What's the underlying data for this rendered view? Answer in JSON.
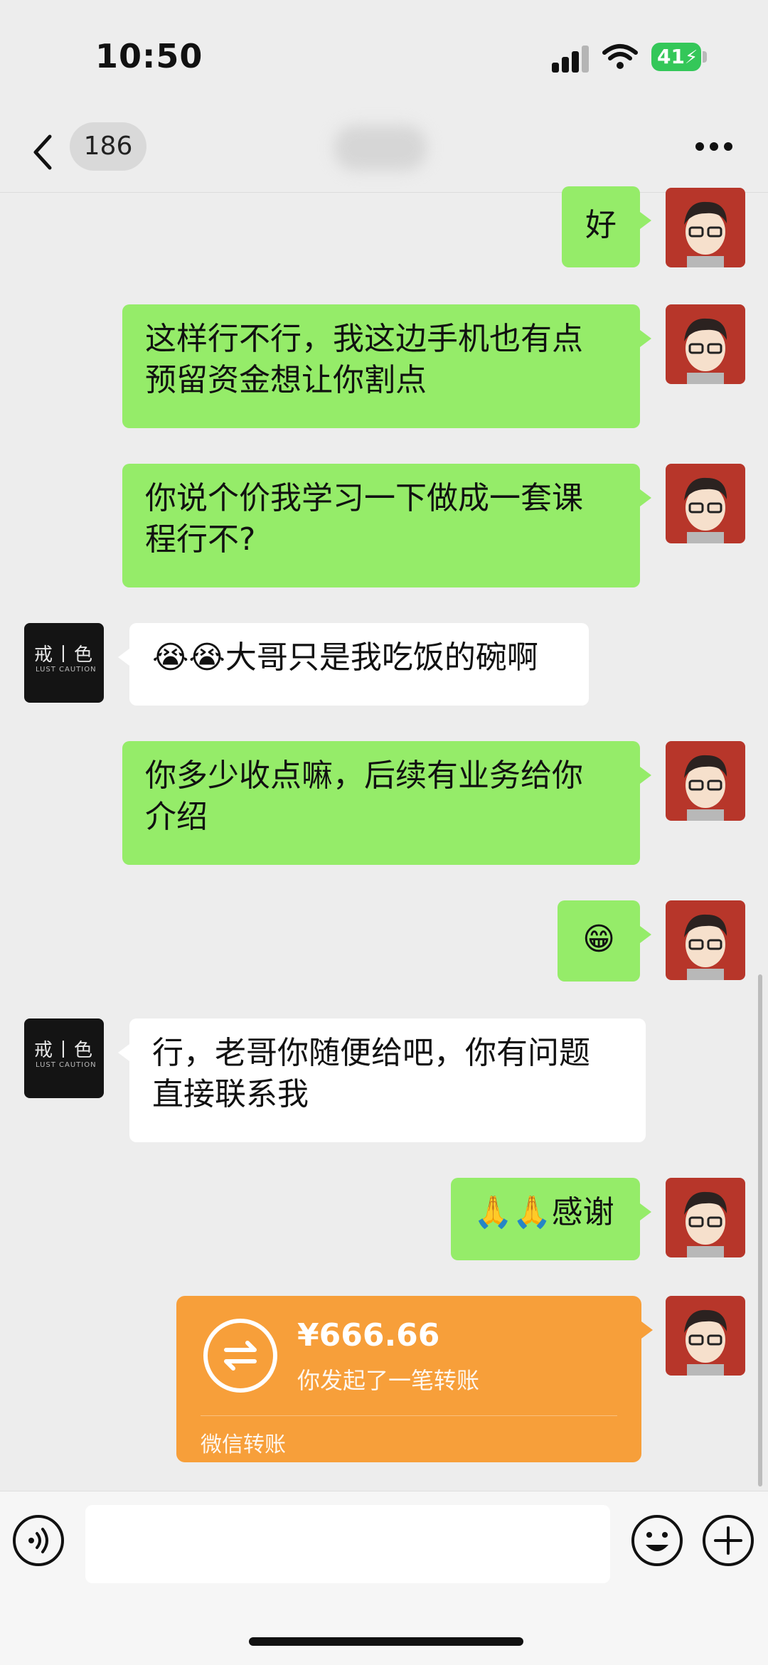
{
  "status_bar": {
    "time": "10:50",
    "battery": "41"
  },
  "nav": {
    "unread_count": "186"
  },
  "messages": [
    {
      "side": "out",
      "text": "好"
    },
    {
      "side": "out",
      "line1": "这样行不行，我这边手机也有点",
      "line2": "预留资金想让你割点"
    },
    {
      "side": "out",
      "line1": "你说个价我学习一下做成一套课",
      "line2": "程行不?"
    },
    {
      "side": "in",
      "emoji": "😭😭",
      "text": "大哥只是我吃饭的碗啊"
    },
    {
      "side": "out",
      "line1": "你多少收点嘛，后续有业务给你",
      "line2": "介绍"
    },
    {
      "side": "out",
      "emoji": "😁"
    },
    {
      "side": "in",
      "line1": "行，老哥你随便给吧，你有问题",
      "line2": "直接联系我"
    },
    {
      "side": "out",
      "emoji": "🙏🙏",
      "text": "感谢"
    }
  ],
  "transfer": {
    "amount": "¥666.66",
    "note": "你发起了一笔转账",
    "label": "微信转账"
  },
  "other_avatar": {
    "title": "戒丨色",
    "subtitle": "LUST CAUTION"
  },
  "colors": {
    "outgoing_bubble": "#95ec69",
    "incoming_bubble": "#ffffff",
    "transfer": "#f79f3a",
    "background": "#ededed"
  }
}
